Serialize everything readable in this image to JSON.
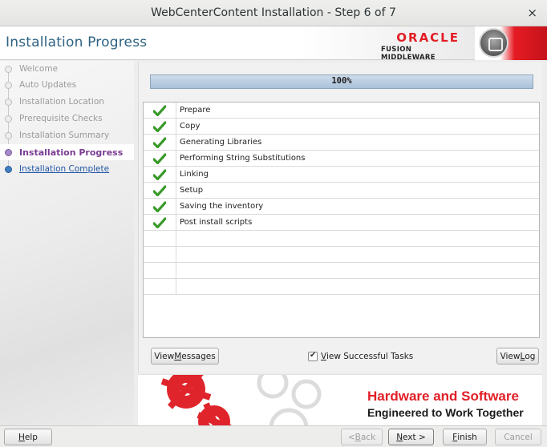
{
  "window": {
    "title": "WebCenterContent Installation - Step 6 of 7",
    "close_glyph": "×"
  },
  "header": {
    "page_title": "Installation Progress",
    "logo_word": "ORACLE",
    "logo_sub": "FUSION MIDDLEWARE"
  },
  "nav": {
    "items": [
      {
        "label": "Welcome",
        "state": "done"
      },
      {
        "label": "Auto Updates",
        "state": "done"
      },
      {
        "label": "Installation Location",
        "state": "done"
      },
      {
        "label": "Prerequisite Checks",
        "state": "done"
      },
      {
        "label": "Installation Summary",
        "state": "done"
      },
      {
        "label": "Installation Progress",
        "state": "active"
      },
      {
        "label": "Installation Complete",
        "state": "link"
      }
    ]
  },
  "progress": {
    "percent_text": "100%",
    "fraction": 1.0
  },
  "tasks": [
    {
      "name": "Prepare",
      "status": "complete"
    },
    {
      "name": "Copy",
      "status": "complete"
    },
    {
      "name": "Generating Libraries",
      "status": "complete"
    },
    {
      "name": "Performing String Substitutions",
      "status": "complete"
    },
    {
      "name": "Linking",
      "status": "complete"
    },
    {
      "name": "Setup",
      "status": "complete"
    },
    {
      "name": "Saving the inventory",
      "status": "complete"
    },
    {
      "name": "Post install scripts",
      "status": "complete"
    }
  ],
  "actions": {
    "view_messages_pre": "View ",
    "view_messages_mn": "M",
    "view_messages_post": "essages",
    "view_successful_pre": "",
    "view_successful_mn": "V",
    "view_successful_post": "iew Successful Tasks",
    "view_successful_checked": true,
    "view_log_pre": "View ",
    "view_log_mn": "L",
    "view_log_post": "og"
  },
  "banner": {
    "line1": "Hardware and Software",
    "line2": "Engineered to Work Together"
  },
  "footer": {
    "help_mn": "H",
    "help_post": "elp",
    "back_pre": "< ",
    "back_mn": "B",
    "back_post": "ack",
    "next_mn": "N",
    "next_post": "ext >",
    "finish_mn": "F",
    "finish_post": "inish",
    "cancel": "Cancel"
  },
  "colors": {
    "accent_blue": "#2e6281",
    "active_purple": "#7a3c92",
    "link_blue": "#1f55a4",
    "check_green": "#3a9a2a",
    "oracle_red": "#e21e26"
  }
}
